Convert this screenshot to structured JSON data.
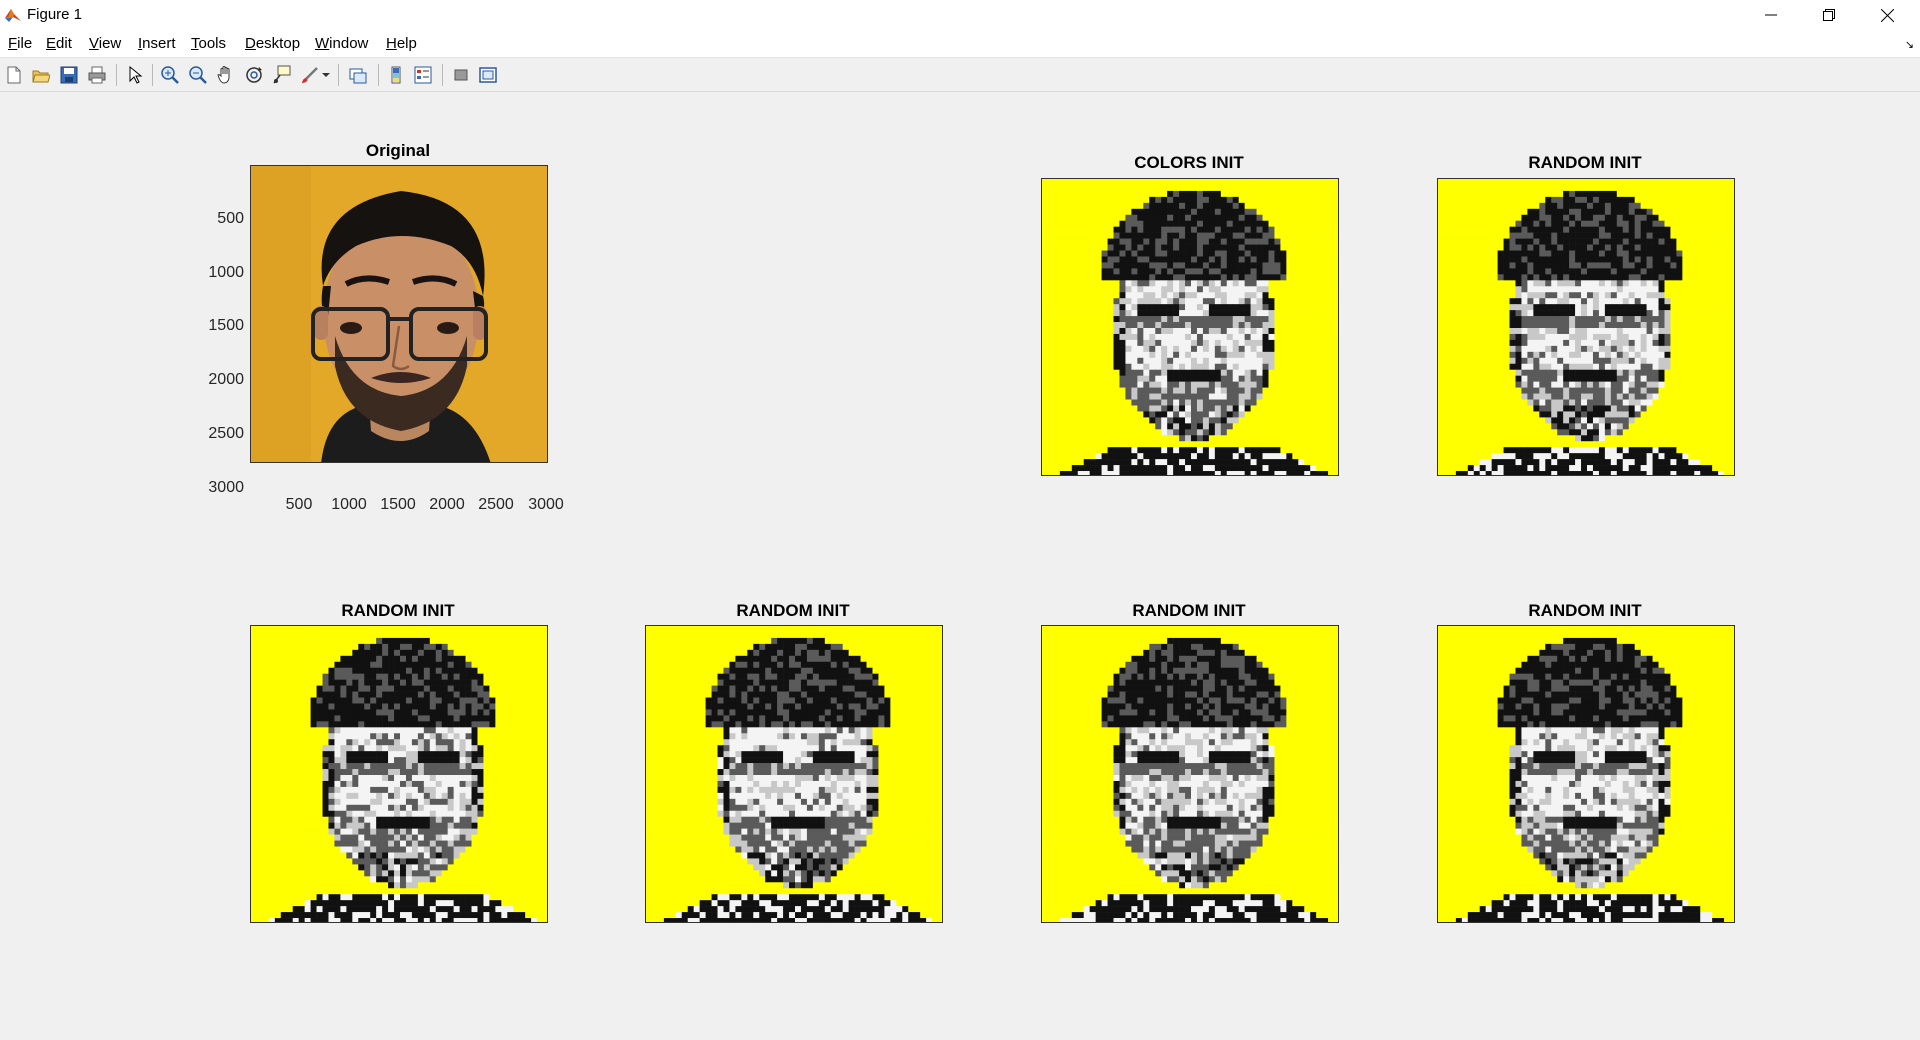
{
  "window": {
    "title": "Figure 1",
    "icon": "matlab-icon",
    "controls": [
      "minimize-icon",
      "restore-icon",
      "close-icon"
    ]
  },
  "menu": {
    "items": [
      {
        "label": "File",
        "ul": "F",
        "rest": "ile"
      },
      {
        "label": "Edit",
        "ul": "E",
        "rest": "dit"
      },
      {
        "label": "View",
        "ul": "V",
        "rest": "iew"
      },
      {
        "label": "Insert",
        "ul": "I",
        "rest": "nsert"
      },
      {
        "label": "Tools",
        "ul": "T",
        "rest": "ools"
      },
      {
        "label": "Desktop",
        "ul": "D",
        "rest": "esktop"
      },
      {
        "label": "Window",
        "ul": "W",
        "rest": "indow"
      },
      {
        "label": "Help",
        "ul": "H",
        "rest": "elp"
      }
    ]
  },
  "toolbar": {
    "buttons": [
      "new-figure-icon",
      "open-file-icon",
      "save-icon",
      "print-icon",
      "edit-plot-icon",
      "zoom-in-icon",
      "zoom-out-icon",
      "pan-icon",
      "rotate-3d-icon",
      "data-cursor-icon",
      "brush-icon",
      "link-plot-icon",
      "insert-colorbar-icon",
      "insert-legend-icon",
      "hide-plot-tools-icon",
      "show-plot-tools-icon"
    ]
  },
  "axes": {
    "original": {
      "title": "Original",
      "yticks": [
        "500",
        "1000",
        "1500",
        "2000",
        "2500",
        "3000"
      ],
      "xticks": [
        "500",
        "1000",
        "1500",
        "2000",
        "2500",
        "3000"
      ]
    },
    "colors_init": {
      "title": "COLORS INIT"
    },
    "random_1": {
      "title": "RANDOM INIT"
    },
    "random_2": {
      "title": "RANDOM INIT"
    },
    "random_3": {
      "title": "RANDOM INIT"
    },
    "random_4": {
      "title": "RANDOM INIT"
    },
    "random_5": {
      "title": "RANDOM INIT"
    }
  },
  "colors": {
    "background_yellow": "#ffff00",
    "photo_background": "#e0a625",
    "black": "#111111",
    "dark_gray": "#5a5a5a",
    "light_gray": "#c8c8c8",
    "white": "#f4f4f4"
  }
}
